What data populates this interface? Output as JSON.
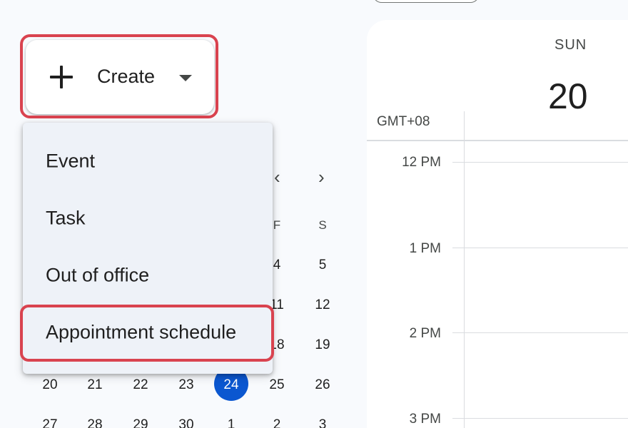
{
  "create": {
    "label": "Create"
  },
  "mini_calendar": {
    "weekday_headers": [
      "F",
      "S"
    ],
    "rows": [
      [
        "4",
        "5"
      ],
      [
        "11",
        "12"
      ],
      [
        "18",
        "19"
      ],
      [
        "20",
        "21",
        "22",
        "23",
        "24",
        "25",
        "26"
      ],
      [
        "27",
        "28",
        "29",
        "30",
        "1",
        "2",
        "3"
      ]
    ],
    "today": "24",
    "accent_color": "#0b57d0"
  },
  "create_menu": {
    "items": [
      "Event",
      "Task",
      "Out of office",
      "Appointment schedule"
    ],
    "highlight_color": "#d9434f"
  },
  "day_view": {
    "day_name": "SUN",
    "day_number": "20",
    "timezone": "GMT+08",
    "hours": [
      "12 PM",
      "1 PM",
      "2 PM",
      "3 PM"
    ]
  }
}
